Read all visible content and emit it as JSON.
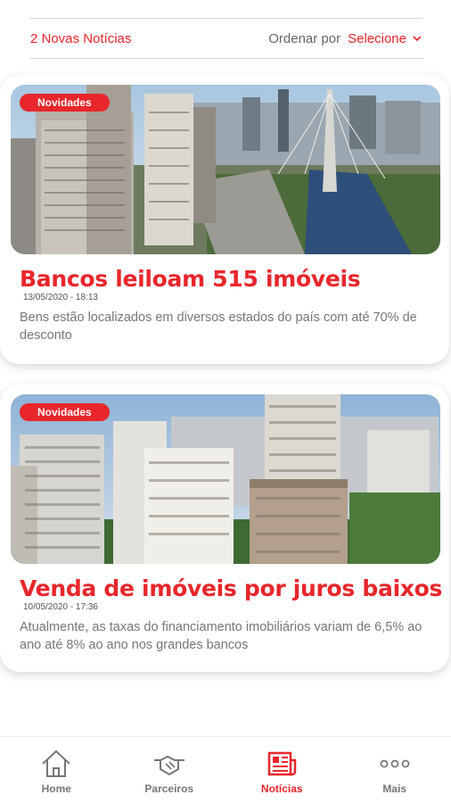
{
  "header": {
    "new_count": "2 Novas Notícias",
    "sort_label": "Ordenar por",
    "sort_value": "Selecione"
  },
  "news": [
    {
      "badge": "Novidades",
      "title": "Bancos leiloam 515 imóveis",
      "date": "13/05/2020 - 18:13",
      "description": "Bens estão localizados em diversos estados do país com até 70% de desconto"
    },
    {
      "badge": "Novidades",
      "title": "Venda de imóveis por juros baixos",
      "date": "10/05/2020 - 17:36",
      "description": "Atualmente, as taxas do financiamento imobiliários variam de 6,5% ao ano até 8% ao ano nos grandes bancos"
    }
  ],
  "tabbar": {
    "items": [
      {
        "label": "Home",
        "icon": "home-icon"
      },
      {
        "label": "Parceiros",
        "icon": "handshake-icon"
      },
      {
        "label": "Notícias",
        "icon": "newspaper-icon",
        "active": true
      },
      {
        "label": "Mais",
        "icon": "more-icon"
      }
    ]
  },
  "colors": {
    "accent": "#e8262b",
    "text_muted": "#777777"
  }
}
